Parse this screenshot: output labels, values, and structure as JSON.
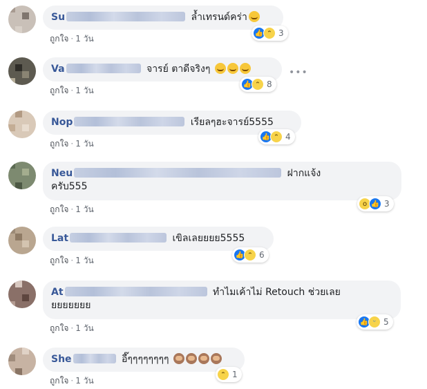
{
  "meta": {
    "like_label": "ถูกใจ",
    "dot": "·",
    "time": "1 วัน"
  },
  "more_label": "•••",
  "comments": [
    {
      "name": "Su",
      "text": "ล้ำเทรนด์คร่า",
      "reaction_count": "3"
    },
    {
      "name": "Va",
      "text": "จารย์ ตาดีจริงๆ",
      "reaction_count": "8"
    },
    {
      "name": "Nop",
      "text": "เรียลๆฮะจารย์5555",
      "reaction_count": "4"
    },
    {
      "name": "Neu",
      "text": "ฝากแจ้ง",
      "text2": "ครับ555",
      "reaction_count": "3"
    },
    {
      "name": "Lat",
      "text": "เขิลเลยยยย5555",
      "reaction_count": "6"
    },
    {
      "name": "At",
      "text": "ทำไมเค้าไม่ Retouch ช่วยเลย",
      "text2": "ยยยยยยย",
      "reaction_count": "5"
    },
    {
      "name": "She",
      "text": "อี๊ๆๆๆๆๆๆๆๆ",
      "reaction_count": "1"
    }
  ]
}
